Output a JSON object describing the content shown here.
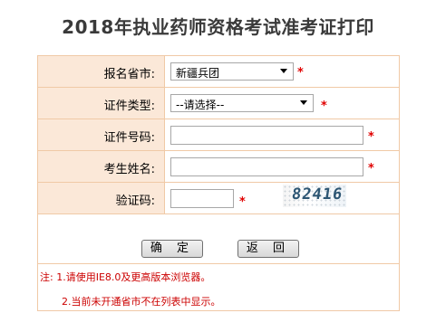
{
  "page": {
    "title": "2018年执业药师资格考试准考证打印"
  },
  "form": {
    "province": {
      "label": "报名省市:",
      "selected": "新疆兵团",
      "required_mark": "*"
    },
    "id_type": {
      "label": "证件类型:",
      "selected": "--请选择--",
      "required_mark": "*"
    },
    "id_number": {
      "label": "证件号码:",
      "value": "",
      "required_mark": "*"
    },
    "name": {
      "label": "考生姓名:",
      "value": "",
      "required_mark": "*"
    },
    "captcha": {
      "label": "验证码:",
      "value": "",
      "code": "82416",
      "required_mark": "*"
    }
  },
  "buttons": {
    "confirm_label": "确 定",
    "back_label": "返 回"
  },
  "notes": {
    "line1": "注: 1.请使用IE8.0及更高版本浏览器。",
    "line2": "2.当前未开通省市不在列表中显示。"
  },
  "colors": {
    "label_bg": "#fbe8d8",
    "border": "#f0c9a6",
    "required": "#e00000",
    "note_text": "#cc0000"
  }
}
